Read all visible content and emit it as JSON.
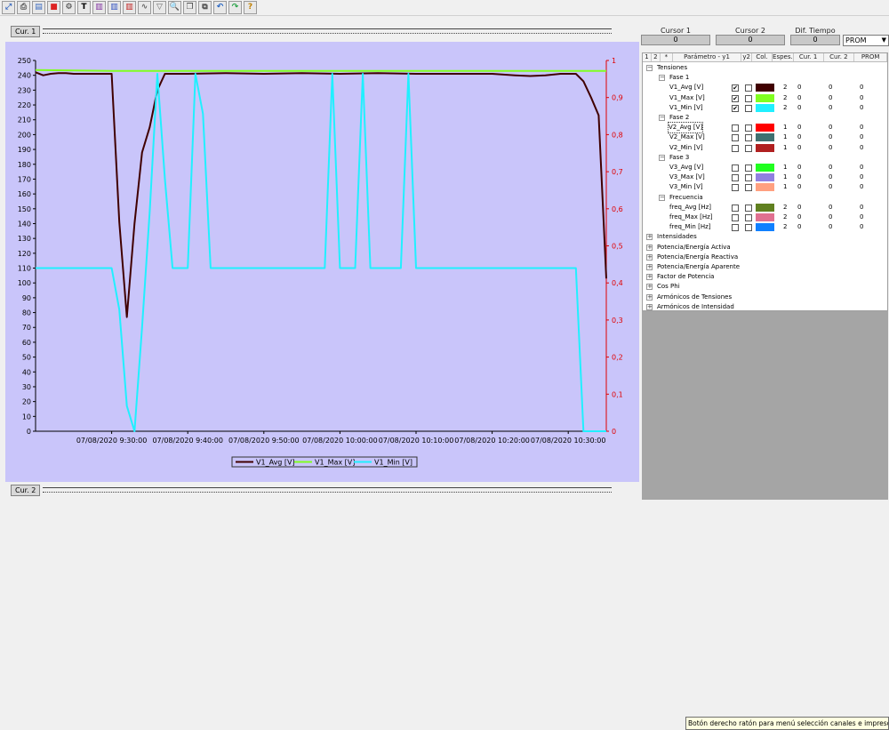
{
  "toolbar": {
    "icons": [
      "zoom-fit-icon",
      "print-icon",
      "page-icon",
      "stop-icon",
      "chart-icon",
      "text-icon",
      "chart-bars-icon",
      "chart-bars-blue-icon",
      "chart-bars-red-icon",
      "wave-icon",
      "triangle-icon",
      "zoom-icon",
      "copy-icon",
      "export-icon",
      "undo-icon",
      "redo-icon",
      "help-icon"
    ],
    "glyphs": [
      "⤢",
      "⎙",
      "▤",
      "■",
      "⚙",
      "T",
      "▥",
      "▥",
      "▥",
      "∿",
      "▽",
      "🔍",
      "❐",
      "⧉",
      "↶",
      "↷",
      "?"
    ],
    "colors": [
      "#3a6ac0",
      "#555",
      "#3a6ac0",
      "#d22",
      "#333",
      "#000",
      "#8030a0",
      "#3050c0",
      "#c02020",
      "#666",
      "#666",
      "#444",
      "#444",
      "#444",
      "#2060c0",
      "#20a040",
      "#c08000"
    ]
  },
  "cursor1_label": "Cur. 1",
  "cursor2_label": "Cur. 2",
  "right": {
    "cursor1_header": "Cursor 1",
    "cursor2_header": "Cursor 2",
    "diff_header": "Dif. Tiempo",
    "cursor1_value": "0",
    "cursor2_value": "0",
    "diff_value": "0",
    "mode_value": "PROM",
    "columns": [
      "1",
      "2",
      "*",
      "Parámetro - y1",
      "y2",
      "Col.",
      "Espes.",
      "Cur. 1",
      "Cur. 2",
      "PROM"
    ],
    "tooltip": "Botón derecho ratón para menú selección canales e impresora"
  },
  "tree": [
    {
      "type": "group",
      "level": 0,
      "label": "Tensiones",
      "expanded": true
    },
    {
      "type": "group",
      "level": 1,
      "label": "Fase 1",
      "expanded": true
    },
    {
      "type": "param",
      "label": "V1_Avg [V]",
      "y1": true,
      "y2": false,
      "color": "#400000",
      "width": "2",
      "cur1": "0",
      "cur2": "0",
      "prom": "0"
    },
    {
      "type": "param",
      "label": "V1_Max [V]",
      "y1": true,
      "y2": false,
      "color": "#80ff20",
      "width": "2",
      "cur1": "0",
      "cur2": "0",
      "prom": "0"
    },
    {
      "type": "param",
      "label": "V1_Min [V]",
      "y1": true,
      "y2": false,
      "color": "#20f0ff",
      "width": "2",
      "cur1": "0",
      "cur2": "0",
      "prom": "0"
    },
    {
      "type": "group",
      "level": 1,
      "label": "Fase 2",
      "expanded": true
    },
    {
      "type": "param",
      "label": "V2_Avg [V]",
      "y1": false,
      "y2": false,
      "color": "#ff0000",
      "width": "1",
      "cur1": "0",
      "cur2": "0",
      "prom": "0",
      "selected": true
    },
    {
      "type": "param",
      "label": "V2_Max [V]",
      "y1": false,
      "y2": false,
      "color": "#407070",
      "width": "1",
      "cur1": "0",
      "cur2": "0",
      "prom": "0"
    },
    {
      "type": "param",
      "label": "V2_Min [V]",
      "y1": false,
      "y2": false,
      "color": "#b02020",
      "width": "1",
      "cur1": "0",
      "cur2": "0",
      "prom": "0"
    },
    {
      "type": "group",
      "level": 1,
      "label": "Fase 3",
      "expanded": true
    },
    {
      "type": "param",
      "label": "V3_Avg [V]",
      "y1": false,
      "y2": false,
      "color": "#20ff20",
      "width": "1",
      "cur1": "0",
      "cur2": "0",
      "prom": "0"
    },
    {
      "type": "param",
      "label": "V3_Max [V]",
      "y1": false,
      "y2": false,
      "color": "#9080e0",
      "width": "1",
      "cur1": "0",
      "cur2": "0",
      "prom": "0"
    },
    {
      "type": "param",
      "label": "V3_Min [V]",
      "y1": false,
      "y2": false,
      "color": "#ffa080",
      "width": "1",
      "cur1": "0",
      "cur2": "0",
      "prom": "0"
    },
    {
      "type": "group",
      "level": 1,
      "label": "Frecuencia",
      "expanded": true
    },
    {
      "type": "param",
      "label": "freq_Avg [Hz]",
      "y1": false,
      "y2": false,
      "color": "#608020",
      "width": "2",
      "cur1": "0",
      "cur2": "0",
      "prom": "0"
    },
    {
      "type": "param",
      "label": "freq_Max [Hz]",
      "y1": false,
      "y2": false,
      "color": "#e07090",
      "width": "2",
      "cur1": "0",
      "cur2": "0",
      "prom": "0"
    },
    {
      "type": "param",
      "label": "freq_Min [Hz]",
      "y1": false,
      "y2": false,
      "color": "#1080ff",
      "width": "2",
      "cur1": "0",
      "cur2": "0",
      "prom": "0"
    },
    {
      "type": "group",
      "level": 0,
      "label": "Intensidades",
      "expanded": false
    },
    {
      "type": "group",
      "level": 0,
      "label": "Potencia/Energía Activa",
      "expanded": false
    },
    {
      "type": "group",
      "level": 0,
      "label": "Potencia/Energía Reactiva",
      "expanded": false
    },
    {
      "type": "group",
      "level": 0,
      "label": "Potencia/Energía Aparente",
      "expanded": false
    },
    {
      "type": "group",
      "level": 0,
      "label": "Factor de Potencia",
      "expanded": false
    },
    {
      "type": "group",
      "level": 0,
      "label": "Cos Phi",
      "expanded": false
    },
    {
      "type": "group",
      "level": 0,
      "label": "Armónicos de Tensiones",
      "expanded": false
    },
    {
      "type": "group",
      "level": 0,
      "label": "Armónicos de Intensidad",
      "expanded": false
    }
  ],
  "chart_data": {
    "type": "line",
    "y1_ticks": [
      "0",
      "10",
      "20",
      "30",
      "40",
      "50",
      "60",
      "70",
      "80",
      "90",
      "100",
      "110",
      "120",
      "130",
      "140",
      "150",
      "160",
      "170",
      "180",
      "190",
      "200",
      "210",
      "220",
      "230",
      "240",
      "250"
    ],
    "y2_ticks": [
      "0",
      "0,1",
      "0,2",
      "0,3",
      "0,4",
      "0,5",
      "0,6",
      "0,7",
      "0,8",
      "0,9",
      "1"
    ],
    "x_ticks": [
      "07/08/2020 9:30:00",
      "07/08/2020 9:40:00",
      "07/08/2020 9:50:00",
      "07/08/2020 10:00:00",
      "07/08/2020 10:10:00",
      "07/08/2020 10:20:00",
      "07/08/2020 10:30:00"
    ],
    "ylim": [
      0,
      250
    ],
    "y2lim": [
      0,
      1
    ],
    "grid": false,
    "legend_position": "bottom-center",
    "series": [
      {
        "name": "V1_Avg [V]",
        "color": "#400000",
        "x": [
          "9:20:00",
          "9:21:00",
          "9:22:00",
          "9:23:00",
          "9:24:00",
          "9:25:00",
          "9:26:00",
          "9:27:00",
          "9:28:00",
          "9:29:00",
          "9:30:00",
          "9:31:00",
          "9:32:00",
          "9:33:00",
          "9:34:00",
          "9:35:00",
          "9:36:00",
          "9:37:00",
          "9:38:00",
          "9:39:00",
          "9:40:00",
          "9:45:00",
          "9:50:00",
          "9:55:00",
          "10:00:00",
          "10:05:00",
          "10:10:00",
          "10:15:00",
          "10:20:00",
          "10:23:00",
          "10:25:00",
          "10:27:00",
          "10:29:00",
          "10:30:00",
          "10:31:00",
          "10:32:00",
          "10:33:00",
          "10:34:00",
          "10:35:00"
        ],
        "y": [
          242,
          240,
          241,
          241.5,
          241.5,
          241,
          241,
          241,
          241,
          241,
          241,
          141,
          77,
          140,
          188,
          205,
          230,
          241,
          241,
          241,
          241,
          241.5,
          241,
          241.5,
          241,
          241.5,
          241,
          241,
          241,
          240,
          239.5,
          240,
          241,
          241,
          241,
          236,
          225,
          213,
          103
        ]
      },
      {
        "name": "V1_Max [V]",
        "color": "#80ff20",
        "x": [
          "9:20:00",
          "9:30:00",
          "9:40:00",
          "9:50:00",
          "10:00:00",
          "10:10:00",
          "10:20:00",
          "10:30:00",
          "10:35:00"
        ],
        "y": [
          243.5,
          243,
          243,
          243,
          243,
          243,
          243,
          243,
          243
        ]
      },
      {
        "name": "V1_Min [V]",
        "color": "#20f0ff",
        "x": [
          "9:20:00",
          "9:21:00",
          "9:22:00",
          "9:23:00",
          "9:24:00",
          "9:25:00",
          "9:26:00",
          "9:27:00",
          "9:28:00",
          "9:29:00",
          "9:30:00",
          "9:31:00",
          "9:32:00",
          "9:33:00",
          "9:34:00",
          "9:35:00",
          "9:36:00",
          "9:37:00",
          "9:38:00",
          "9:39:00",
          "9:40:00",
          "9:41:00",
          "9:42:00",
          "9:43:00",
          "9:44:00",
          "9:45:00",
          "9:50:00",
          "9:55:00",
          "9:56:00",
          "9:57:00",
          "9:58:00",
          "9:59:00",
          "10:00:00",
          "10:01:00",
          "10:02:00",
          "10:03:00",
          "10:04:00",
          "10:05:00",
          "10:06:00",
          "10:07:00",
          "10:08:00",
          "10:09:00",
          "10:10:00",
          "10:11:00",
          "10:12:00",
          "10:13:00",
          "10:14:00",
          "10:15:00",
          "10:20:00",
          "10:25:00",
          "10:27:00",
          "10:28:00",
          "10:29:00",
          "10:30:00",
          "10:31:00",
          "10:32:00",
          "10:33:00",
          "10:35:00"
        ],
        "y": [
          110,
          110,
          110,
          110,
          110,
          110,
          110,
          110,
          110,
          110,
          110,
          82,
          17,
          0,
          70,
          148,
          241,
          170,
          110,
          110,
          110,
          241,
          214,
          110,
          110,
          110,
          110,
          110,
          110,
          110,
          110,
          241,
          110,
          110,
          110,
          241,
          110,
          110,
          110,
          110,
          110,
          241,
          110,
          110,
          110,
          110,
          110,
          110,
          110,
          110,
          110,
          110,
          110,
          110,
          110,
          0,
          0,
          0
        ]
      }
    ]
  }
}
